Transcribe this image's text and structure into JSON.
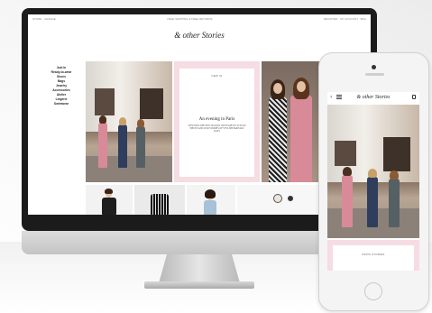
{
  "desktop": {
    "topbar": {
      "left": "STORE · CHANGE",
      "center": "FREE SHIPPING & FREE RETURNS",
      "right": "REGISTER · MY ACCOUNT · BAG"
    },
    "logo": "& other Stories",
    "sidebar": {
      "items": [
        "Just In",
        "Ready-to-wear",
        "Shoes",
        "Bags",
        "Jewelry",
        "Accessories",
        "Atelier",
        "Lingerie",
        "Swimwear"
      ]
    },
    "article": {
      "kicker": "NEW IN",
      "title": "An evening in Paris",
      "body": "STEP INTO THE NEW SEASON WITH SUBTLY STYLED PIECES AND OUR STORIES OF STYLISH PARISIAN DAYS"
    }
  },
  "mobile": {
    "logo": "& other Stories",
    "back_glyph": "‹",
    "article_kicker": "PARIS STORIES"
  },
  "colors": {
    "monitor_frame": "#1b1b1b",
    "article_pink": "#f6dce3",
    "suit_pink": "#d98a98"
  }
}
